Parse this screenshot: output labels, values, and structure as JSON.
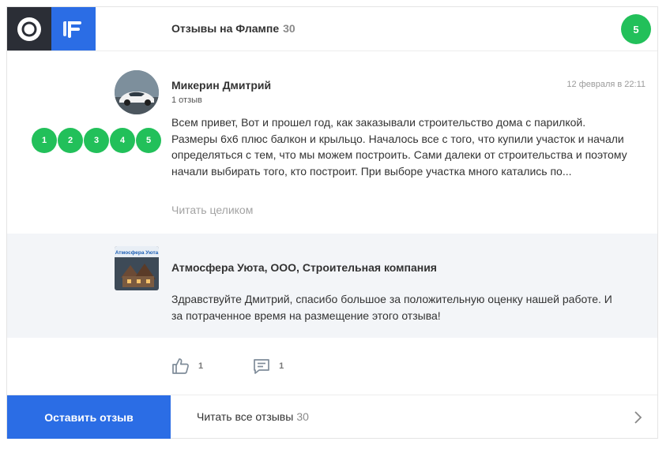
{
  "header": {
    "title": "Отзывы на Флампе",
    "count": "30",
    "rating": "5",
    "logo_left_icon": "2gis-logo-icon",
    "logo_right_icon": "flamp-logo-icon"
  },
  "review": {
    "author": "Микерин Дмитрий",
    "reviews_count": "1 отзыв",
    "date": "12 февраля в 22:11",
    "stars": [
      "1",
      "2",
      "3",
      "4",
      "5"
    ],
    "text": "Всем привет, Вот и прошел год, как заказывали строительство дома с парилкой. Размеры 6х6 плюс балкон и крыльцо. Началось все с того, что купили участок и начали определяться с тем, что мы можем построить. Сами далеки от строительства и поэтому начали выбирать того, кто построит. При выборе участка много катались по...",
    "read_more": "Читать целиком"
  },
  "reply": {
    "company": "Атмосфера Уюта, ООО, Строительная компания",
    "logo_text": "Атмосфера Уюта",
    "text": "Здравствуйте Дмитрий, спасибо большое за положительную оценку нашей работе. И за потраченное время на размещение этого отзыва!"
  },
  "actions": {
    "likes": "1",
    "comments": "1"
  },
  "footer": {
    "cta_label": "Оставить отзыв",
    "read_all_label": "Читать все отзывы",
    "read_all_count": "30"
  },
  "colors": {
    "accent_blue": "#2b6de5",
    "rating_green": "#22c05a",
    "dark": "#2b2e36"
  }
}
